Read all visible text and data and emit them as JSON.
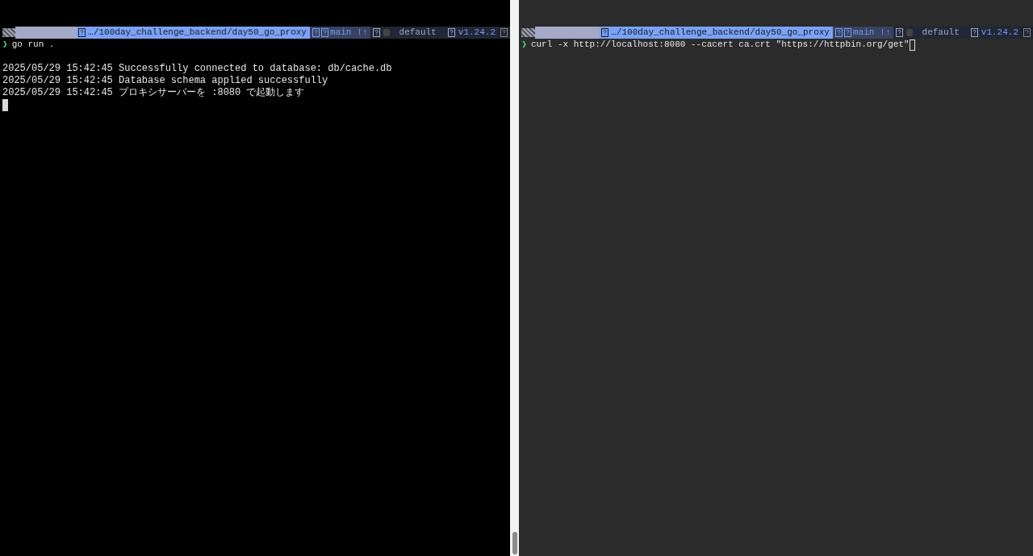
{
  "panes": [
    {
      "kind": "dark",
      "prompt": {
        "path": "…/100day_challenge_backend/day50_go_proxy",
        "branch": "main",
        "git_status": "!↑",
        "context": "default",
        "version": "v1.24.2"
      },
      "prompt_char": "❯",
      "command": "go run .",
      "output": [
        "2025/05/29 15:42:45 Successfully connected to database: db/cache.db",
        "2025/05/29 15:42:45 Database schema applied successfully",
        "2025/05/29 15:42:45 プロキシサーバーを :8080 で起動します"
      ],
      "focused": true
    },
    {
      "kind": "grey",
      "prompt": {
        "path": "…/100day_challenge_backend/day50_go_proxy",
        "branch": "main",
        "git_status": "!↑",
        "context": "default",
        "version": "v1.24.2"
      },
      "prompt_char": "❯",
      "command": "curl -x http://localhost:8080 --cacert ca.crt \"https://httpbin.org/get\"",
      "focused": false
    }
  ]
}
